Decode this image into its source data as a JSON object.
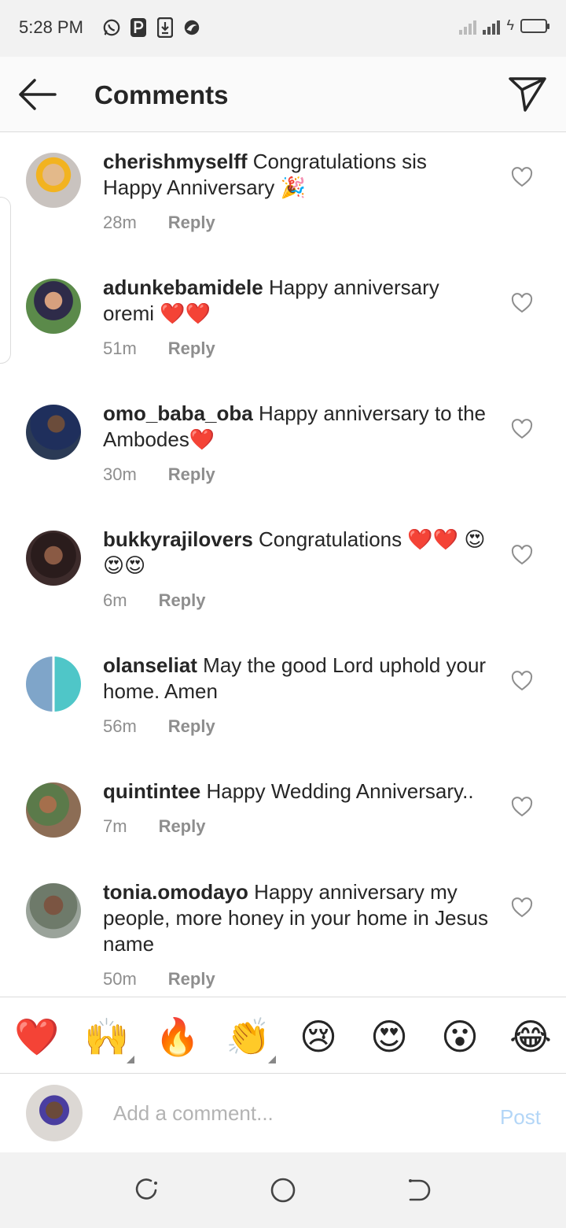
{
  "status_bar": {
    "time": "5:28 PM",
    "left_icons": [
      "whatsapp-icon",
      "p-icon",
      "download-icon",
      "app-icon"
    ],
    "right_icons": [
      "signal-icon",
      "signal-h-plus-icon",
      "charging-battery-icon"
    ]
  },
  "header": {
    "title": "Comments",
    "back_icon": "arrow-left-icon",
    "send_icon": "paper-plane-icon"
  },
  "comments": [
    {
      "username": "cherishmyselff",
      "text": "Congratulations sis Happy Anniversary 🎉",
      "time": "28m",
      "reply": "Reply"
    },
    {
      "username": "adunkebamidele",
      "text": "Happy anniversary oremi ❤️❤️",
      "time": "51m",
      "reply": "Reply"
    },
    {
      "username": "omo_baba_oba",
      "text": "Happy anniversary to the Ambodes❤️",
      "time": "30m",
      "reply": "Reply"
    },
    {
      "username": "bukkyrajilovers",
      "text": "Congratulations ❤️❤️ 😍😍😍",
      "time": "6m",
      "reply": "Reply"
    },
    {
      "username": "olanseliat",
      "text": "May the good Lord uphold your home. Amen",
      "time": "56m",
      "reply": "Reply"
    },
    {
      "username": "quintintee",
      "text": "Happy Wedding Anniversary..",
      "time": "7m",
      "reply": "Reply"
    },
    {
      "username": "tonia.omodayo",
      "text": "Happy anniversary my people, more honey in your home in Jesus name",
      "time": "50m",
      "reply": "Reply"
    }
  ],
  "emoji_bar": [
    "❤️",
    "🙌",
    "🔥",
    "👏",
    "😢",
    "😍",
    "😮",
    "😂"
  ],
  "composer": {
    "placeholder": "Add a comment...",
    "post_label": "Post"
  },
  "nav_bar": [
    "recents-icon",
    "home-circle-icon",
    "back-nav-icon"
  ],
  "colors": {
    "status_bar_bg": "#f2f2f2",
    "header_bg": "#fafafa",
    "text": "#262626",
    "meta": "#8e8e8e",
    "post_disabled": "#b3d6f7"
  }
}
